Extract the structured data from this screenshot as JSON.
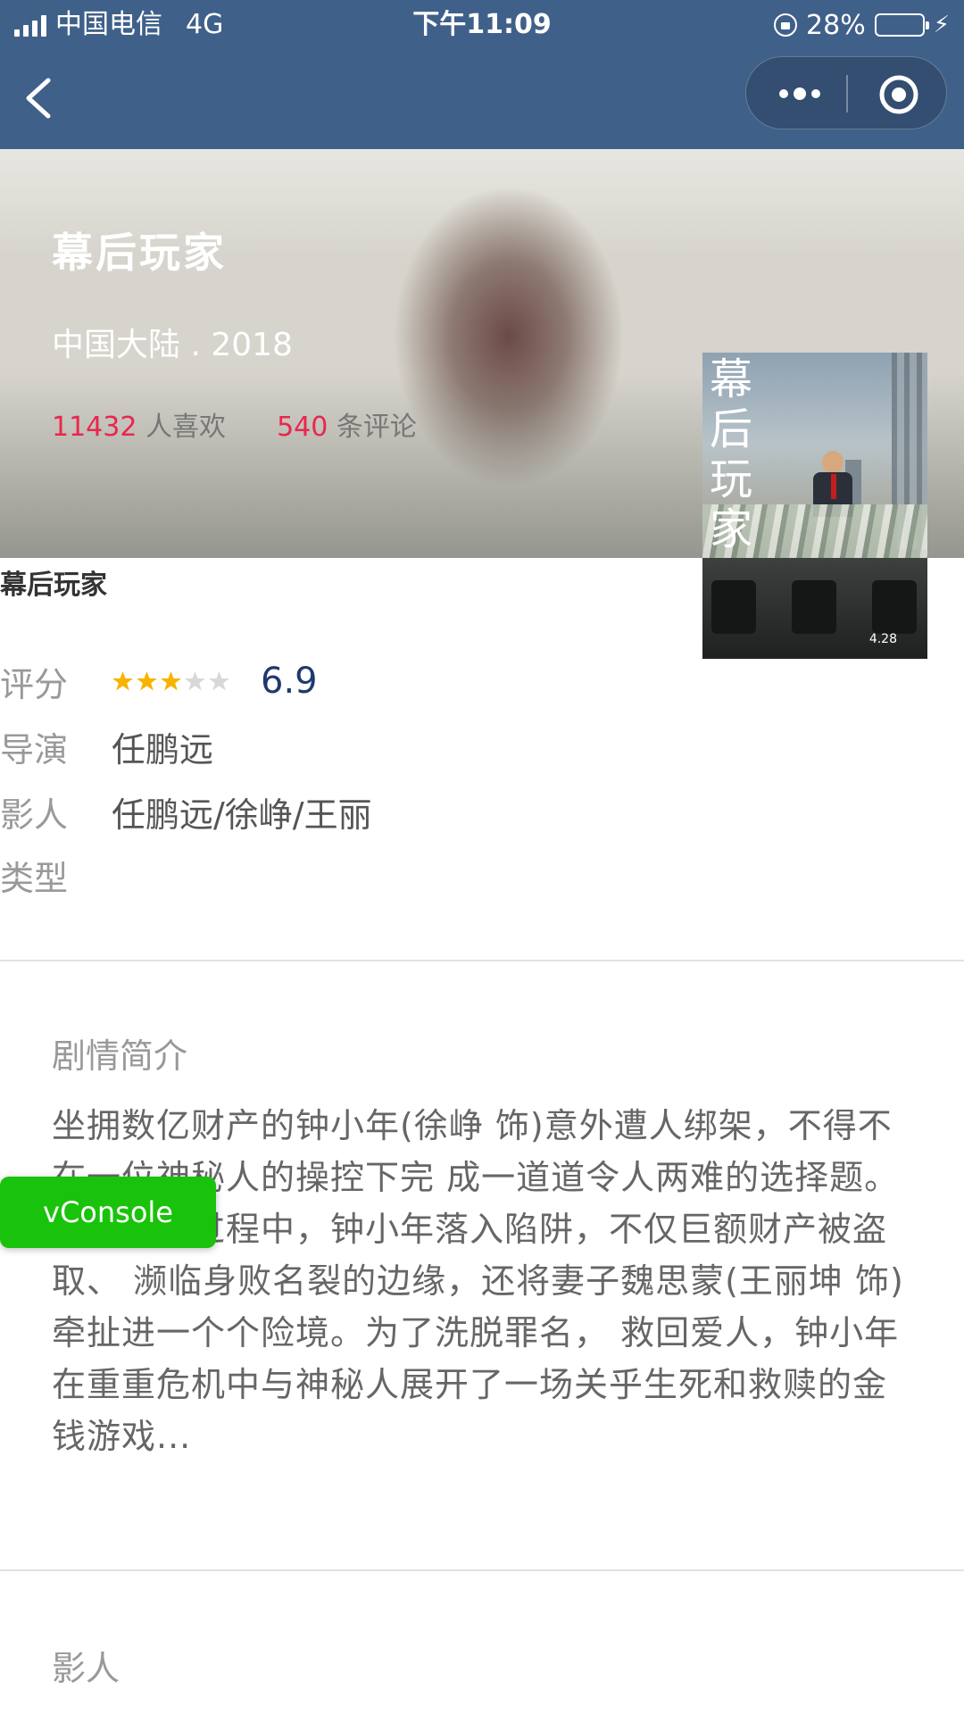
{
  "status_bar": {
    "carrier": "中国电信",
    "network": "4G",
    "time": "下午11:09",
    "battery_pct": "28%",
    "battery_level": 0.28,
    "colors": {
      "bar": "#3f6089",
      "battery_fill": "#4cd964"
    }
  },
  "nav": {
    "back_icon": "chevron-left-icon",
    "more_icon": "more-dots-icon",
    "close_icon": "target-circle-icon"
  },
  "hero": {
    "title": "幕后玩家",
    "meta": "中国大陆 . 2018",
    "likes_count": "11432",
    "likes_label": "人喜欢",
    "comments_count": "540",
    "comments_label": "条评论",
    "accent_color": "#e8274d"
  },
  "poster": {
    "title_chars": [
      "幕",
      "后",
      "玩",
      "家"
    ],
    "date": "4.28"
  },
  "info": {
    "title": "幕后玩家",
    "rating_label": "评分",
    "rating_stars": 3,
    "rating_max": 5,
    "score": "6.9",
    "director_label": "导演",
    "director": "任鹏远",
    "cast_label": "影人",
    "cast": "任鹏远/徐峥/王丽",
    "genre_label": "类型",
    "genre": ""
  },
  "summary": {
    "heading": "剧情简介",
    "text": "坐拥数亿财产的钟小年(徐峥 饰)意外遭人绑架，不得不在一位神秘人的操控下完 成一道道令人两难的选择题。在选择的过程中，钟小年落入陷阱，不仅巨额财产被盗取、 濒临身败名裂的边缘，还将妻子魏思蒙(王丽坤 饰)牵扯进一个个险境。为了洗脱罪名， 救回爱人，钟小年在重重危机中与神秘人展开了一场关乎生死和救赎的金钱游戏..."
  },
  "cast_section": {
    "heading": "影人"
  },
  "vconsole": {
    "label": "vConsole",
    "color": "#19c30b"
  }
}
